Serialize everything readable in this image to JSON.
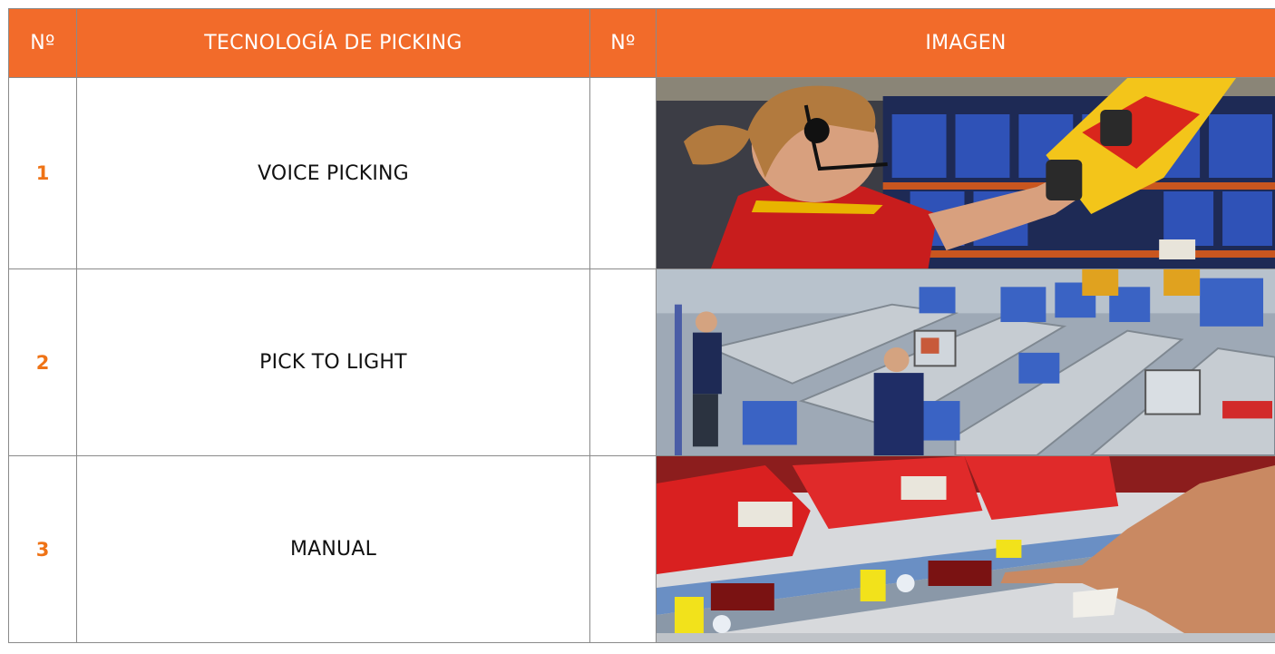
{
  "table": {
    "headers": [
      "Nº",
      "TECNOLOGÍA DE PICKING",
      "Nº",
      "IMAGEN"
    ],
    "rows": [
      {
        "num": "1",
        "technology": "VOICE PICKING",
        "num2": "",
        "image": "warehouse-voice-picking-photo"
      },
      {
        "num": "2",
        "technology": "PICK TO LIGHT",
        "num2": "",
        "image": "conveyor-pick-to-light-photo"
      },
      {
        "num": "3",
        "technology": "MANUAL",
        "num2": "",
        "image": "hand-pressing-shelf-light-photo"
      }
    ]
  },
  "colors": {
    "header_bg": "#f26b2a",
    "number_text": "#ef7316"
  }
}
